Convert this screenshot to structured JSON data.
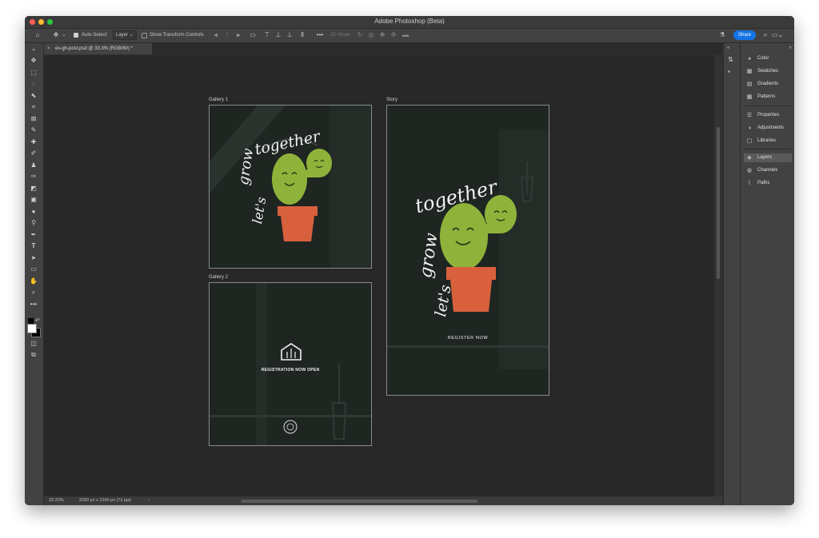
{
  "app": {
    "title": "Adobe Photoshop (Beta)"
  },
  "options_bar": {
    "home_icon": "home-icon",
    "move_icon": "move-icon",
    "auto_select_label": "Auto-Select:",
    "auto_select_value": "Layer",
    "show_transform_label": "Show Transform Controls",
    "mode_3d_label": "3D Mode:",
    "share_label": "Share"
  },
  "document_tab": {
    "label": "ev-gh-post.psd @ 33.3% (RGB/8#) *"
  },
  "status_bar": {
    "zoom": "33.33%",
    "doc_size": "2260 px x 2260 px (72 ppi)"
  },
  "artboards": {
    "gallery1": {
      "label": "Gallery 1",
      "line1": "together",
      "line2": "grow",
      "line3": "let's"
    },
    "gallery2": {
      "label": "Gallery 2",
      "cta": "REGISTRATION NOW OPEN"
    },
    "story": {
      "label": "Story",
      "line1": "together",
      "line2": "grow",
      "line3": "let's",
      "cta": "REGISTER NOW"
    }
  },
  "right_panel": {
    "items": [
      {
        "label": "Color",
        "icon": "color-icon"
      },
      {
        "label": "Swatches",
        "icon": "swatches-icon"
      },
      {
        "label": "Gradients",
        "icon": "gradients-icon"
      },
      {
        "label": "Patterns",
        "icon": "patterns-icon"
      },
      {
        "label": "Properties",
        "icon": "properties-icon"
      },
      {
        "label": "Adjustments",
        "icon": "adjustments-icon"
      },
      {
        "label": "Libraries",
        "icon": "libraries-icon"
      },
      {
        "label": "Layers",
        "icon": "layers-icon"
      },
      {
        "label": "Channels",
        "icon": "channels-icon"
      },
      {
        "label": "Paths",
        "icon": "paths-icon"
      }
    ]
  },
  "colors": {
    "accent": "#1473e6",
    "cactus": "#8fb33a",
    "pot": "#d9603d",
    "artboard_bg": "#1f2622"
  }
}
